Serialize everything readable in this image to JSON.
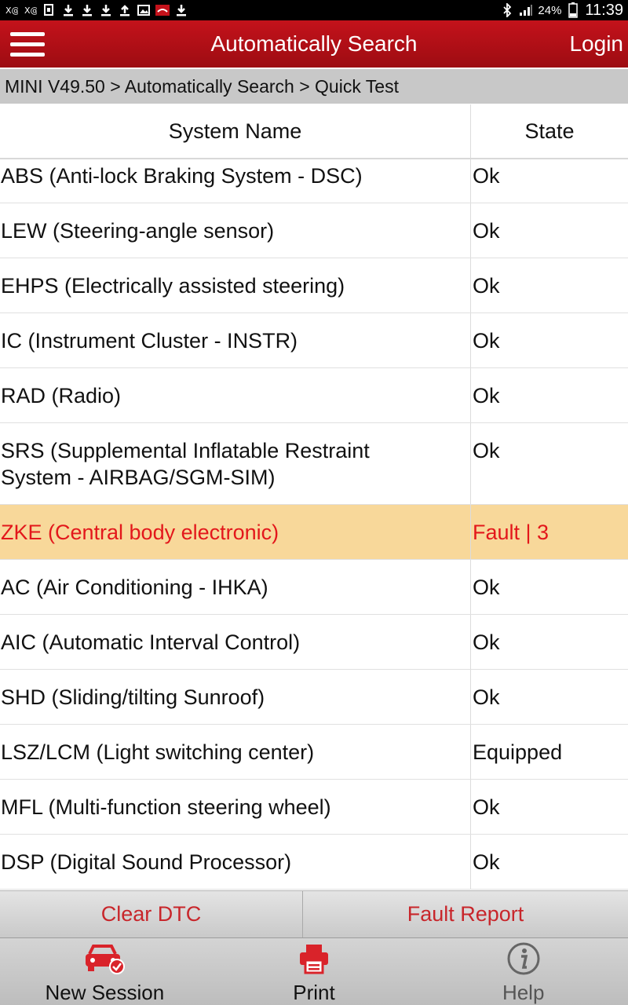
{
  "status_bar": {
    "battery": "24%",
    "time": "11:39"
  },
  "app_bar": {
    "title": "Automatically Search",
    "login": "Login"
  },
  "breadcrumb": "MINI V49.50 > Automatically Search > Quick Test",
  "table": {
    "headers": {
      "system_name": "System Name",
      "state": "State"
    },
    "rows": [
      {
        "name": "ABS (Anti-lock Braking System - DSC)",
        "state": "Ok"
      },
      {
        "name": "LEW (Steering-angle sensor)",
        "state": "Ok"
      },
      {
        "name": "EHPS (Electrically assisted steering)",
        "state": "Ok"
      },
      {
        "name": "IC (Instrument Cluster - INSTR)",
        "state": "Ok"
      },
      {
        "name": "RAD (Radio)",
        "state": "Ok"
      },
      {
        "name_line1": "SRS (Supplemental Inflatable Restraint",
        "name_line2": "System - AIRBAG/SGM-SIM)",
        "state": "Ok"
      },
      {
        "name": "ZKE (Central body electronic)",
        "state": "Fault | 3"
      },
      {
        "name": "AC (Air Conditioning - IHKA)",
        "state": "Ok"
      },
      {
        "name": "AIC (Automatic Interval Control)",
        "state": "Ok"
      },
      {
        "name": "SHD (Sliding/tilting Sunroof)",
        "state": "Ok"
      },
      {
        "name": "LSZ/LCM (Light switching center)",
        "state": "Equipped"
      },
      {
        "name": "MFL (Multi-function steering wheel)",
        "state": "Ok"
      },
      {
        "name": "DSP (Digital Sound Processor)",
        "state": "Ok"
      }
    ]
  },
  "actions": {
    "clear_dtc": "Clear DTC",
    "fault_report": "Fault Report"
  },
  "bottom_nav": {
    "new_session": "New Session",
    "print": "Print",
    "help": "Help"
  },
  "colors": {
    "brand_red": "#b3101a",
    "fault_highlight": "#f8d89a",
    "fault_text": "#e3171b"
  }
}
